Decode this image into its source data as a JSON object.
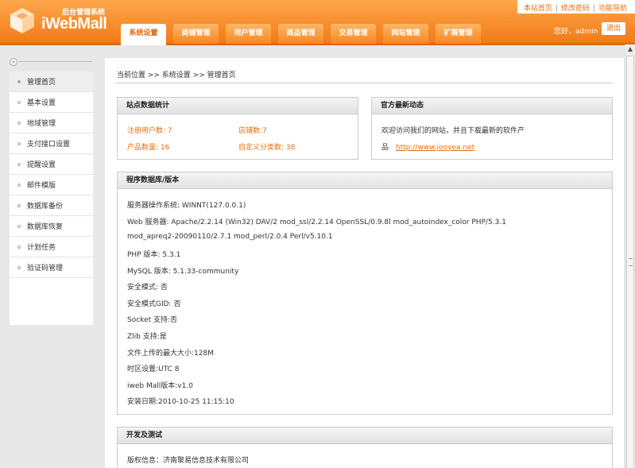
{
  "header": {
    "logo_sub": "后台管理系统",
    "logo_main": "iWebMall",
    "toplinks": [
      "本站首页",
      "修改密码",
      "功能导航"
    ],
    "tabs": [
      "系统设置",
      "商铺管理",
      "用户管理",
      "商品管理",
      "交易管理",
      "网站管理",
      "扩展管理"
    ],
    "greeting": "您好，admin",
    "logout": "退出",
    "accent": "#f07a14"
  },
  "sidebar": {
    "collapse_icon": "«",
    "items": [
      "管理首页",
      "基本设置",
      "地域管理",
      "支付接口设置",
      "提醒设置",
      "邮件模版",
      "数据库备份",
      "数据库恢复",
      "计划任务",
      "验证码管理"
    ]
  },
  "breadcrumb": "当前位置 >> 系统设置 >> 管理首页",
  "stats": {
    "title": "站点数据统计",
    "users": "注册用户数: 7",
    "shops": "店铺数:7",
    "products": "产品数量: 16",
    "categories": "自定义分类数: 38"
  },
  "news": {
    "title": "官方最新动态",
    "text": "欢迎访问我们的网站，并且下载最新的软件产",
    "icon": "品",
    "url": "http://www.jooyea.net"
  },
  "db": {
    "title": "程序数据库/版本",
    "lines": [
      "服务器操作系统: WINNT(127.0.0.1)",
      "Web 服务器: Apache/2.2.14 (Win32) DAV/2 mod_ssl/2.2.14 OpenSSL/0.9.8l mod_autoindex_color PHP/5.3.1",
      "mod_apreq2-20090110/2.7.1 mod_perl/2.0.4 Perl/v5.10.1",
      "PHP 版本: 5.3.1",
      "MySQL 版本: 5.1.33-community",
      "安全模式: 否",
      "安全模式GID: 否",
      "Socket 支持:否",
      "Zlib 支持:是",
      "文件上传的最大大小:128M",
      "时区设置:UTC 8",
      "iweb Mall版本:v1.0",
      "安装日期:2010-10-25 11:15:10"
    ]
  },
  "dev": {
    "title": "开发及测试",
    "copyright": "版权信息：济南聚易信息技术有限公司"
  }
}
